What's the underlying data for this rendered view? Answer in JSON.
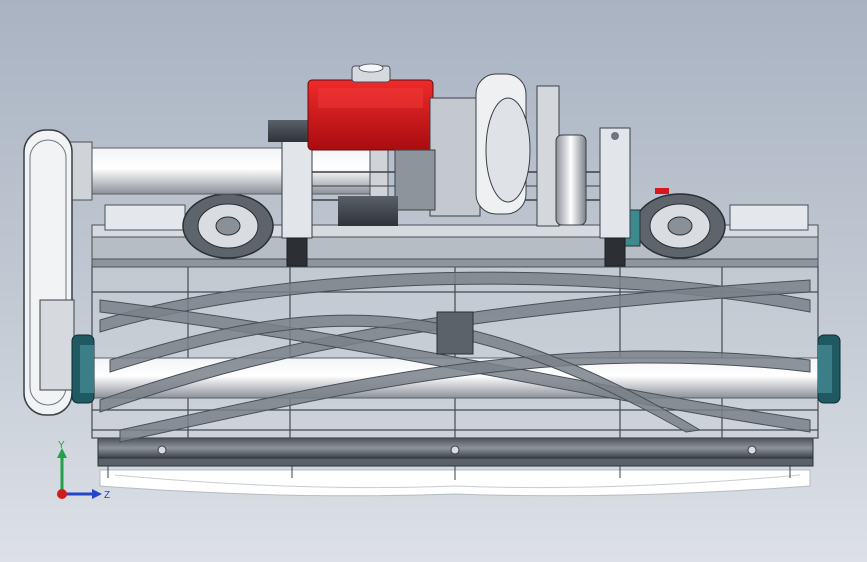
{
  "viewport": {
    "background_top": "#a9b3c2",
    "background_bottom": "#dde1e7"
  },
  "model": {
    "engine_color": "#d8161c",
    "frame_color": "#9aa0a8",
    "reel_color": "#6f7680",
    "hub_color": "#1f5a63"
  },
  "triad": {
    "x_label": "",
    "y_label": "Y",
    "z_label": "Z",
    "x_color": "#d21c1c",
    "y_color": "#22a04a",
    "z_color": "#2446c8"
  }
}
